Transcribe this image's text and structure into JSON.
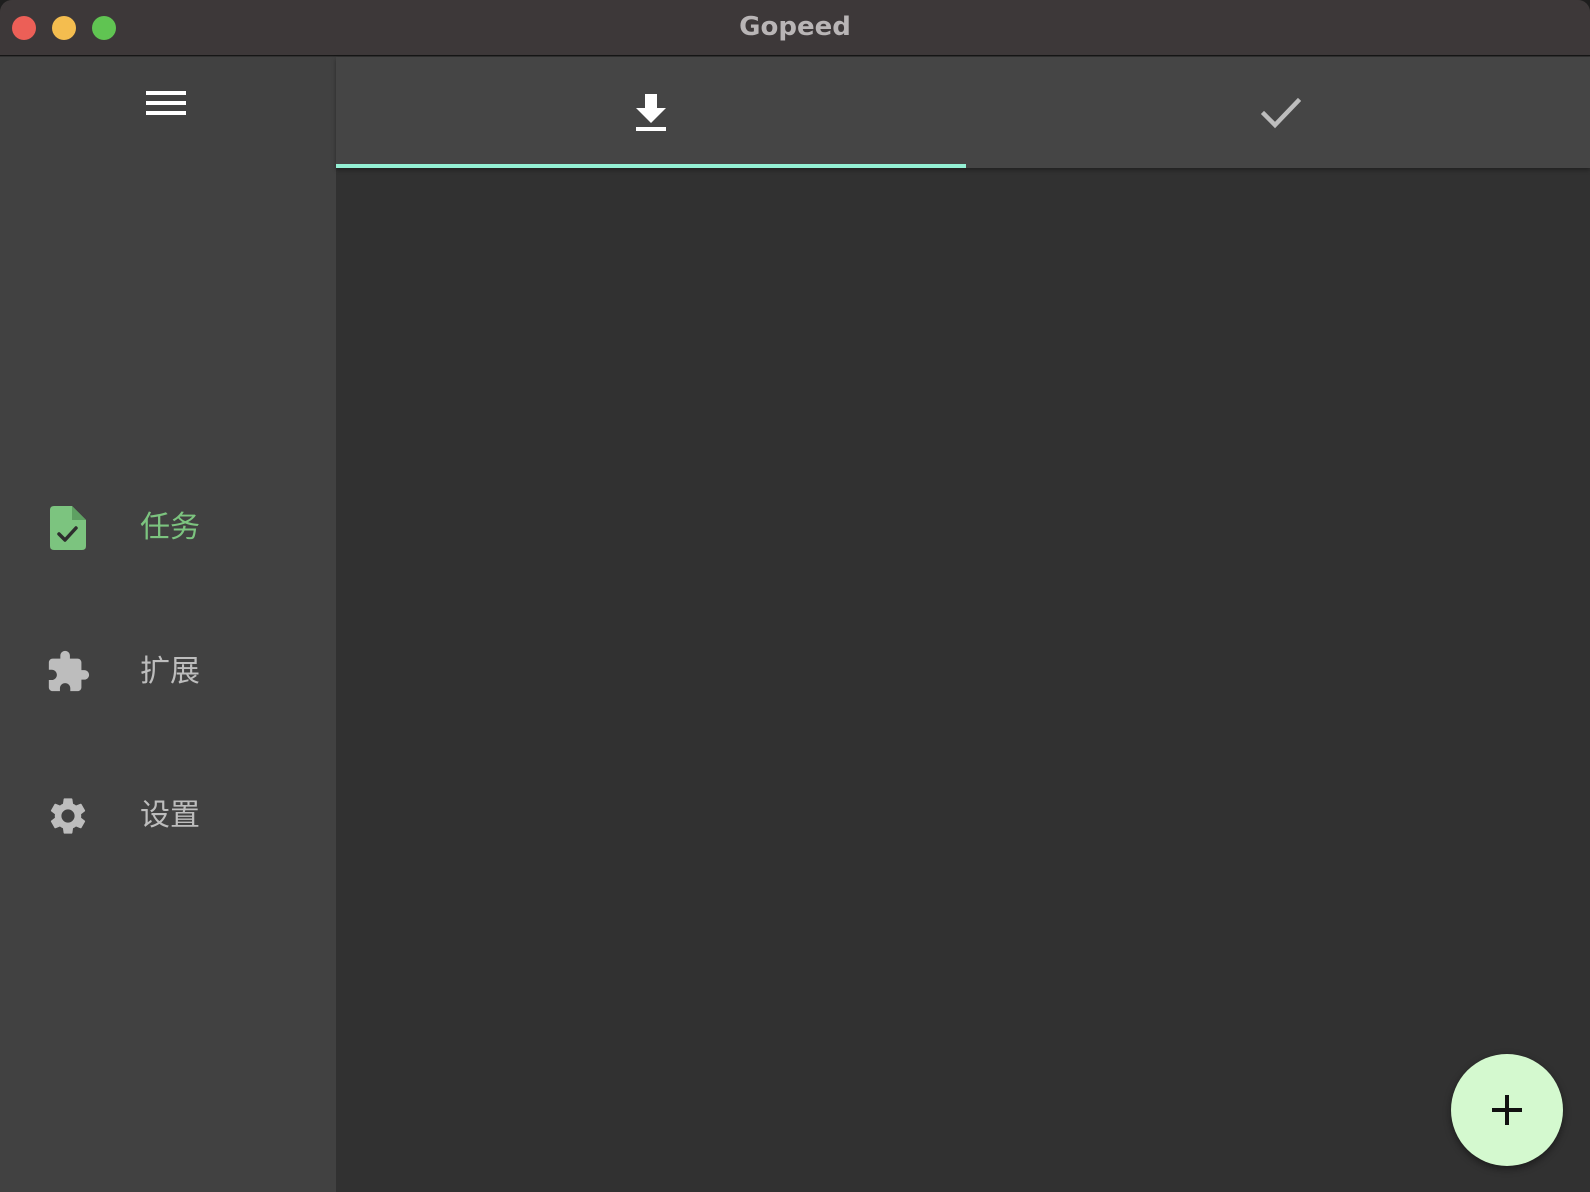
{
  "window": {
    "title": "Gopeed",
    "controls": [
      "close",
      "minimize",
      "maximize"
    ]
  },
  "sidebar": {
    "menu_icon": "hamburger-menu-icon",
    "items": [
      {
        "label": "任务",
        "icon": "task-file-check-icon",
        "active": true
      },
      {
        "label": "扩展",
        "icon": "extension-puzzle-icon",
        "active": false
      },
      {
        "label": "设置",
        "icon": "gear-icon",
        "active": false
      }
    ]
  },
  "tabs": [
    {
      "icon": "download-icon",
      "selected": true
    },
    {
      "icon": "check-icon",
      "selected": false
    }
  ],
  "fab": {
    "icon": "plus-icon"
  },
  "colors": {
    "accent_green": "#7cc47f",
    "tab_indicator": "#94f0d4",
    "fab_background": "#d4f9cf",
    "sidebar_background": "#414141",
    "content_background": "#313131",
    "titlebar_background": "#3d3839"
  }
}
